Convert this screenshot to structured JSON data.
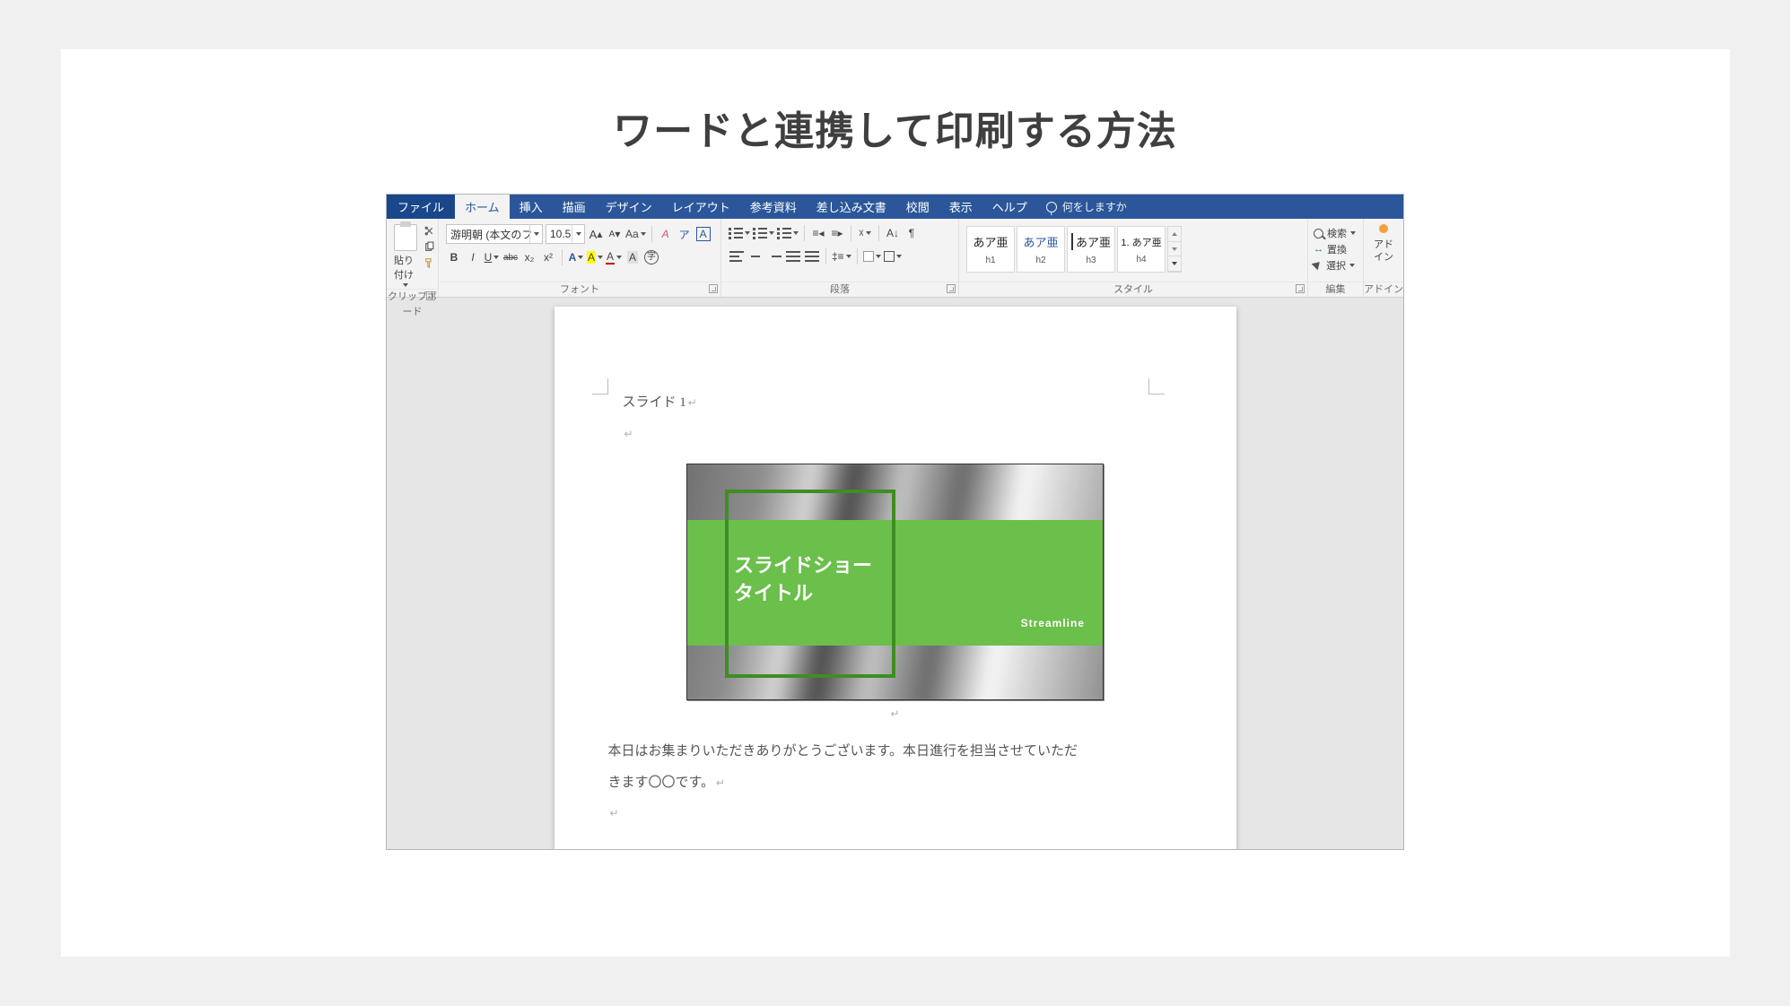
{
  "page_heading": "ワードと連携して印刷する方法",
  "ribbon": {
    "tabs": {
      "file": "ファイル",
      "home": "ホーム",
      "insert": "挿入",
      "draw": "描画",
      "design": "デザイン",
      "layout": "レイアウト",
      "references": "参考資料",
      "mailings": "差し込み文書",
      "review": "校閲",
      "view": "表示",
      "help": "ヘルプ"
    },
    "tell_me": "何をしますか",
    "groups": {
      "clipboard": "クリップボード",
      "font": "フォント",
      "paragraph": "段落",
      "styles": "スタイル",
      "editing": "編集",
      "addins": "アドイン"
    },
    "clipboard": {
      "paste": "貼り付け"
    },
    "font": {
      "font_name": "游明朝 (本文のフ",
      "font_size": "10.5",
      "grow": "A",
      "shrink": "A",
      "case": "Aa",
      "ruby": "ア",
      "char_border": "A",
      "bold": "B",
      "italic": "I",
      "underline": "U",
      "strike": "abc",
      "sub": "x₂",
      "sup": "x²",
      "text_effects": "A",
      "highlight": "A",
      "font_color": "A",
      "char_shading": "A",
      "enclose": "字"
    },
    "styles": {
      "items": [
        {
          "sample": "あア亜",
          "name": "h1"
        },
        {
          "sample": "あア亜",
          "name": "h2"
        },
        {
          "sample": "あア亜",
          "name": "h3"
        },
        {
          "sample": "1. あア亜",
          "name": "h4"
        }
      ]
    },
    "editing": {
      "find": "検索",
      "replace": "置換",
      "select": "選択"
    },
    "addins": {
      "label1": "アド",
      "label2": "イン"
    }
  },
  "document": {
    "slide_label": "スライド 1",
    "slide_title_line1": "スライドショー",
    "slide_title_line2": "タイトル",
    "slide_brand": "Streamline",
    "body_line1": "本日はお集まりいただきありがとうございます。本日進行を担当させていただ",
    "body_line2": "きます〇〇です。"
  }
}
